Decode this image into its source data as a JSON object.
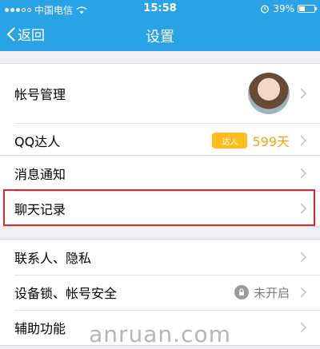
{
  "status": {
    "carrier": "中国电信",
    "time": "15:58",
    "battery": "39%",
    "battery_level": 0.39
  },
  "nav": {
    "back_label": "返回",
    "title": "设置"
  },
  "group1": [
    {
      "label": "帐号管理"
    },
    {
      "label": "QQ达人",
      "badge": "达人",
      "value": "599天"
    }
  ],
  "group2": [
    {
      "label": "消息通知"
    },
    {
      "label": "聊天记录"
    }
  ],
  "group3": [
    {
      "label": "联系人、隐私"
    },
    {
      "label": "设备锁、帐号安全",
      "value": "未开启"
    },
    {
      "label": "辅助功能"
    }
  ],
  "watermark": "anruan.com"
}
